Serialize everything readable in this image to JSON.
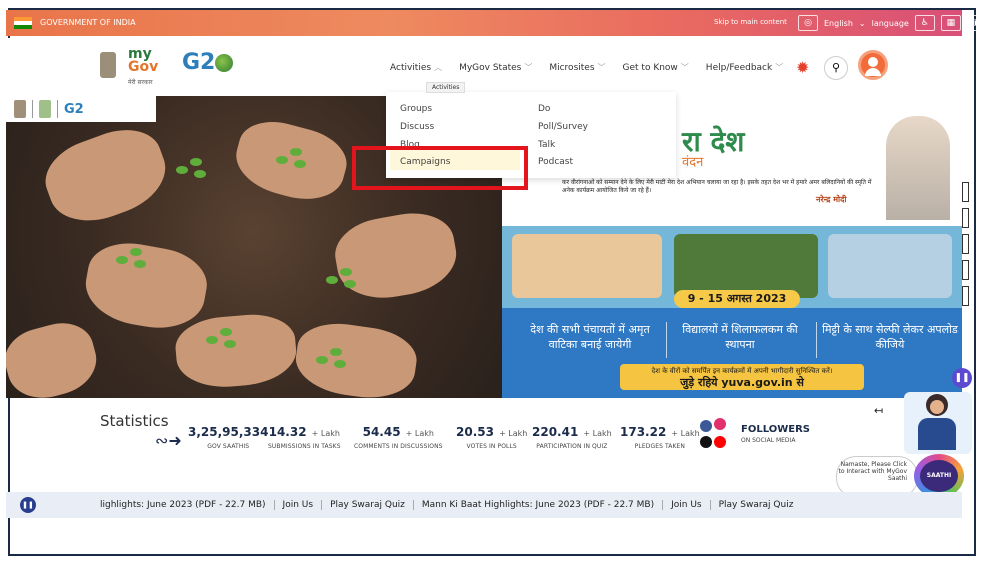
{
  "govbar": {
    "label": "GOVERNMENT OF INDIA",
    "skip": "Skip to main content",
    "language_current": "English",
    "language_label": "language"
  },
  "header": {
    "logo_top": "my",
    "logo_main": "Gov",
    "logo_sub": "मेरी सरकार",
    "g20": "G2",
    "nav": [
      {
        "label": "Activities",
        "chev": "^"
      },
      {
        "label": "MyGov States",
        "chev": "v"
      },
      {
        "label": "Microsites",
        "chev": "v"
      },
      {
        "label": "Get to Know",
        "chev": "v"
      },
      {
        "label": "Help/Feedback",
        "chev": "v"
      }
    ]
  },
  "dropdown": {
    "tooltip": "Activities",
    "left_items": [
      "Groups",
      "Discuss",
      "Blog",
      "Campaigns"
    ],
    "right_items": [
      "Do",
      "Poll/Survey",
      "Talk",
      "Podcast"
    ]
  },
  "banner": {
    "hindi_big": "रा देश",
    "hindi_sub": "वंदन",
    "line1": "कर वीरांगनाओं को सम्मान देने के लिए मेरी माटी मेरा देश अभियान चलाया जा रहा है। इसके तहत देश भर में हमारे अमर बलिदानियों की स्मृति में अनेक कार्यक्रम आयोजित किये जा रहे हैं।",
    "modi_name": "नरेन्द्र मोदी",
    "date": "9 - 15 अगस्त 2023",
    "cols": [
      "देश की सभी पंचायतों में अमृत वाटिका बनाई जायेगी",
      "विद्यालयों में शिलाफलकम की स्थापना",
      "मिट्टी के साथ सेल्फी लेकर अपलोड कीजिये"
    ],
    "yuva_line": "देश के वीरों को समर्पित इन कार्यक्रमों में अपनी भागीदारी सुनिश्चित करें।",
    "yuva_link": "जुड़े रहिये yuva.gov.in से"
  },
  "stats": {
    "title": "Statistics",
    "items": [
      {
        "value": "3,25,95,334",
        "unit": "",
        "label": "GOV SAATHIS"
      },
      {
        "value": "14.32",
        "unit": "+ Lakh",
        "label": "SUBMISSIONS IN TASKS"
      },
      {
        "value": "54.45",
        "unit": "+ Lakh",
        "label": "COMMENTS IN DISCUSSIONS"
      },
      {
        "value": "20.53",
        "unit": "+ Lakh",
        "label": "VOTES IN POLLS"
      },
      {
        "value": "220.41",
        "unit": "+ Lakh",
        "label": "PARTICIPATION IN QUIZ"
      },
      {
        "value": "173.22",
        "unit": "+ Lakh",
        "label": "PLEDGES TAKEN"
      }
    ],
    "followers": "FOLLOWERS",
    "followers_sub": "ON SOCIAL MEDIA"
  },
  "saathi": {
    "bubble": "Namaste, Please Click to Interact with MyGov Saathi",
    "badge": "SAATHI"
  },
  "ticker": {
    "items": [
      "lighlights: June 2023 (PDF - 22.7 MB)",
      "Join Us",
      "Play Swaraj Quiz",
      "Mann Ki Baat Highlights: June 2023 (PDF - 22.7 MB)",
      "Join Us",
      "Play Swaraj Quiz"
    ]
  },
  "colors": {
    "accent_red": "#e3141b",
    "gov_bar": "#e9744a",
    "ticker_bg": "#e9eef6",
    "banner_blue": "#2f79c4"
  }
}
